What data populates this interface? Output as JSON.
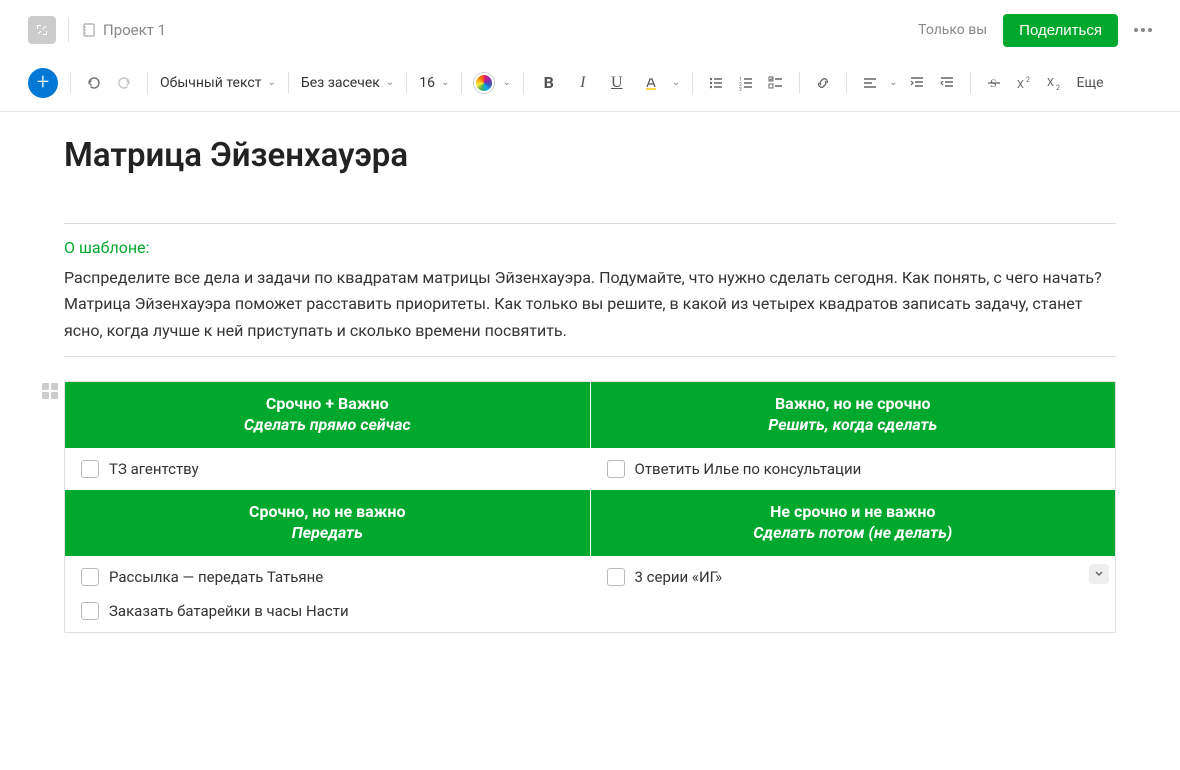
{
  "topbar": {
    "breadcrumb": "Проект 1",
    "share_status": "Только вы",
    "share_button": "Поделиться"
  },
  "toolbar": {
    "style_select": "Обычный текст",
    "font_select": "Без засечек",
    "font_size": "16",
    "more": "Еще"
  },
  "doc": {
    "title": "Матрица Эйзенхауэра",
    "about_label": "О шаблоне:",
    "about_body": "Распределите все дела и задачи по квадратам матрицы Эйзенхауэра. Подумайте, что нужно сделать сегодня. Как понять, с чего начать? Матрица Эйзенхауэра поможет расставить приоритеты. Как только вы решите, в какой из четырех квадратов записать задачу, станет ясно, когда лучше к ней приступать и сколько времени посвятить."
  },
  "matrix": {
    "q1": {
      "title": "Срочно + Важно",
      "subtitle": "Сделать прямо сейчас",
      "tasks": [
        "ТЗ агентству"
      ]
    },
    "q2": {
      "title": "Важно, но не срочно",
      "subtitle": "Решить, когда сделать",
      "tasks": [
        "Ответить Илье по консультации"
      ]
    },
    "q3": {
      "title": "Срочно, но не важно",
      "subtitle": "Передать",
      "tasks": [
        "Рассылка — передать Татьяне",
        "Заказать батарейки в часы Насти"
      ]
    },
    "q4": {
      "title": "Не срочно и не важно",
      "subtitle": "Сделать потом (не делать)",
      "tasks": [
        "3 серии «ИГ»"
      ]
    }
  }
}
